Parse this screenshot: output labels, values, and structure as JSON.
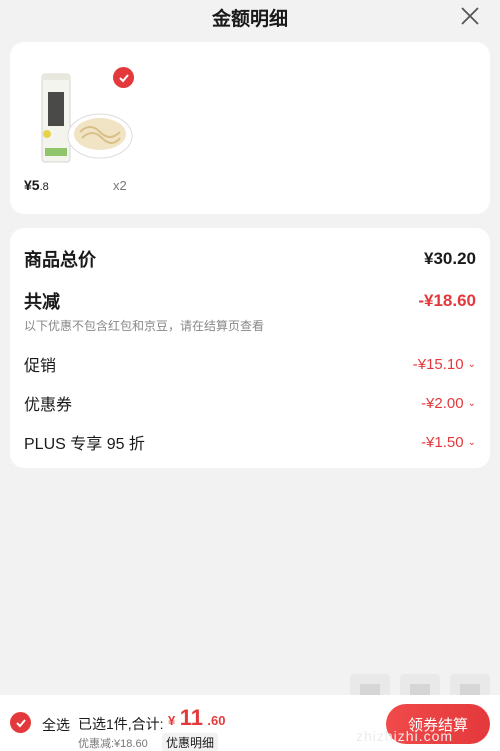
{
  "header": {
    "title": "金额明细",
    "close_icon": "close-icon"
  },
  "product": {
    "image": "product-image",
    "price_int": "¥5",
    "price_dec": ".8",
    "quantity": "x2",
    "checked": true
  },
  "summary": {
    "total_label": "商品总价",
    "total_value": "¥30.20",
    "reduce_label": "共减",
    "reduce_value": "-¥18.60",
    "note": "以下优惠不包含红包和京豆，请在结算页查看",
    "items": [
      {
        "label": "促销",
        "value": "-¥15.10"
      },
      {
        "label": "优惠券",
        "value": "-¥2.00"
      },
      {
        "label": "PLUS 专享 95 折",
        "value": "-¥1.50"
      }
    ],
    "chevron": "⌄"
  },
  "footer": {
    "select_all": "全选",
    "selected_text": "已选1件,合计:",
    "total_currency": "¥",
    "total_int": "11",
    "total_dec": ".60",
    "discount_text": "优惠减:¥18.60",
    "detail_label": "优惠明细",
    "checkout_label": "领券结算"
  },
  "watermark": {
    "text": "zhizhizhi.com"
  },
  "colors": {
    "accent": "#e4393c",
    "background": "#f2f2f2",
    "card": "#ffffff"
  }
}
